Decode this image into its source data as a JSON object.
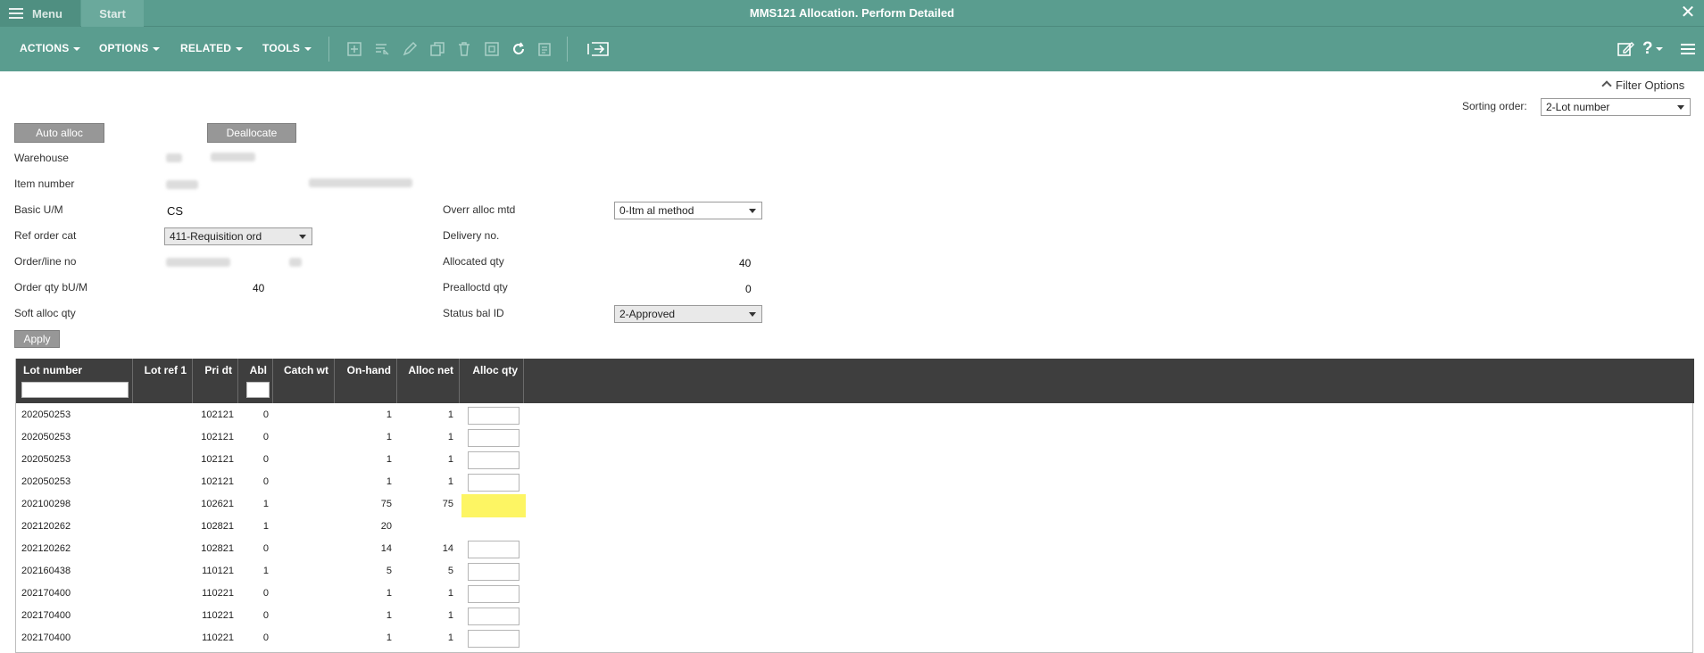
{
  "titlebar": {
    "menu_label": "Menu",
    "start_tab": "Start",
    "title": "MMS121 Allocation. Perform Detailed",
    "close_icon": "close-icon"
  },
  "toolbar": {
    "actions": "ACTIONS",
    "options": "OPTIONS",
    "related": "RELATED",
    "tools": "TOOLS"
  },
  "filter": {
    "filter_options": "Filter Options",
    "sorting_label": "Sorting order:",
    "sorting_value": "2-Lot number"
  },
  "buttons": {
    "auto_alloc": "Auto alloc",
    "deallocate": "Deallocate",
    "apply": "Apply"
  },
  "form": {
    "warehouse_label": "Warehouse",
    "item_number_label": "Item number",
    "basic_um_label": "Basic U/M",
    "basic_um_value": "CS",
    "ref_order_cat_label": "Ref order cat",
    "ref_order_cat_value": "411-Requisition ord",
    "order_line_label": "Order/line no",
    "order_qty_label": "Order qty bU/M",
    "order_qty_value": "40",
    "soft_alloc_label": "Soft alloc qty",
    "overr_alloc_label": "Overr alloc mtd",
    "overr_alloc_value": "0-Itm al method",
    "delivery_label": "Delivery no.",
    "allocated_label": "Allocated qty",
    "allocated_value": "40",
    "prealloc_label": "Prealloctd qty",
    "prealloc_value": "0",
    "status_bal_label": "Status bal ID",
    "status_bal_value": "2-Approved"
  },
  "grid": {
    "columns": [
      "Lot number",
      "Lot ref 1",
      "Pri dt",
      "Abl",
      "Catch wt",
      "On-hand",
      "Alloc net",
      "Alloc qty"
    ],
    "rows": [
      {
        "lot": "202050253",
        "ref": "",
        "pri": "102121",
        "abl": "0",
        "onhand": "1",
        "allocnet": "1"
      },
      {
        "lot": "202050253",
        "ref": "",
        "pri": "102121",
        "abl": "0",
        "onhand": "1",
        "allocnet": "1"
      },
      {
        "lot": "202050253",
        "ref": "",
        "pri": "102121",
        "abl": "0",
        "onhand": "1",
        "allocnet": "1"
      },
      {
        "lot": "202050253",
        "ref": "",
        "pri": "102121",
        "abl": "0",
        "onhand": "1",
        "allocnet": "1"
      },
      {
        "lot": "202100298",
        "ref": "",
        "pri": "102621",
        "abl": "1",
        "onhand": "75",
        "allocnet": "75"
      },
      {
        "lot": "202120262",
        "ref": "",
        "pri": "102821",
        "abl": "1",
        "onhand": "20",
        "allocnet": ""
      },
      {
        "lot": "202120262",
        "ref": "",
        "pri": "102821",
        "abl": "0",
        "onhand": "14",
        "allocnet": "14"
      },
      {
        "lot": "202160438",
        "ref": "",
        "pri": "110121",
        "abl": "1",
        "onhand": "5",
        "allocnet": "5"
      },
      {
        "lot": "202170400",
        "ref": "",
        "pri": "110221",
        "abl": "0",
        "onhand": "1",
        "allocnet": "1"
      },
      {
        "lot": "202170400",
        "ref": "",
        "pri": "110221",
        "abl": "0",
        "onhand": "1",
        "allocnet": "1"
      },
      {
        "lot": "202170400",
        "ref": "",
        "pri": "110221",
        "abl": "0",
        "onhand": "1",
        "allocnet": "1"
      }
    ]
  },
  "colors": {
    "header_teal": "#5a9d8f",
    "grid_header": "#3e3e3e",
    "highlight_yellow": "#fdf563"
  }
}
